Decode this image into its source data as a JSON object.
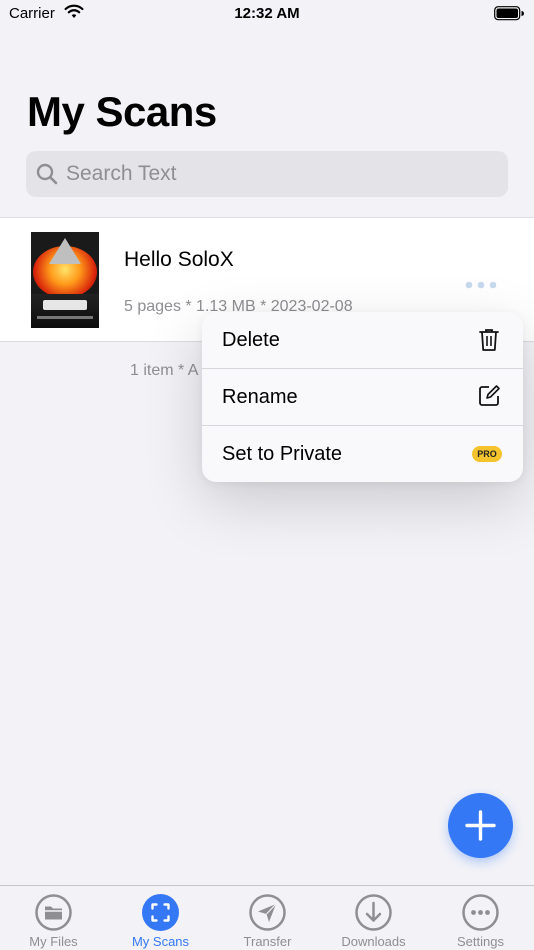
{
  "status_bar": {
    "carrier": "Carrier",
    "time": "12:32 AM"
  },
  "header": {
    "title": "My Scans"
  },
  "search": {
    "placeholder": "Search Text"
  },
  "files": [
    {
      "name": "Hello SoloX",
      "meta": "5 pages * 1.13 MB * 2023-02-08"
    }
  ],
  "footer": {
    "count_text": "1 item * A"
  },
  "context_menu": {
    "items": [
      {
        "label": "Delete",
        "icon": "trash-icon"
      },
      {
        "label": "Rename",
        "icon": "edit-icon"
      },
      {
        "label": "Set to Private",
        "badge": "PRO"
      }
    ]
  },
  "tabs": [
    {
      "label": "My Files",
      "icon": "folder-icon"
    },
    {
      "label": "My Scans",
      "icon": "scan-icon",
      "active": true
    },
    {
      "label": "Transfer",
      "icon": "send-icon"
    },
    {
      "label": "Downloads",
      "icon": "download-icon"
    },
    {
      "label": "Settings",
      "icon": "more-icon"
    }
  ],
  "colors": {
    "accent": "#3478f6",
    "pro_badge": "#f5c32c",
    "background": "#f2f2f7"
  }
}
